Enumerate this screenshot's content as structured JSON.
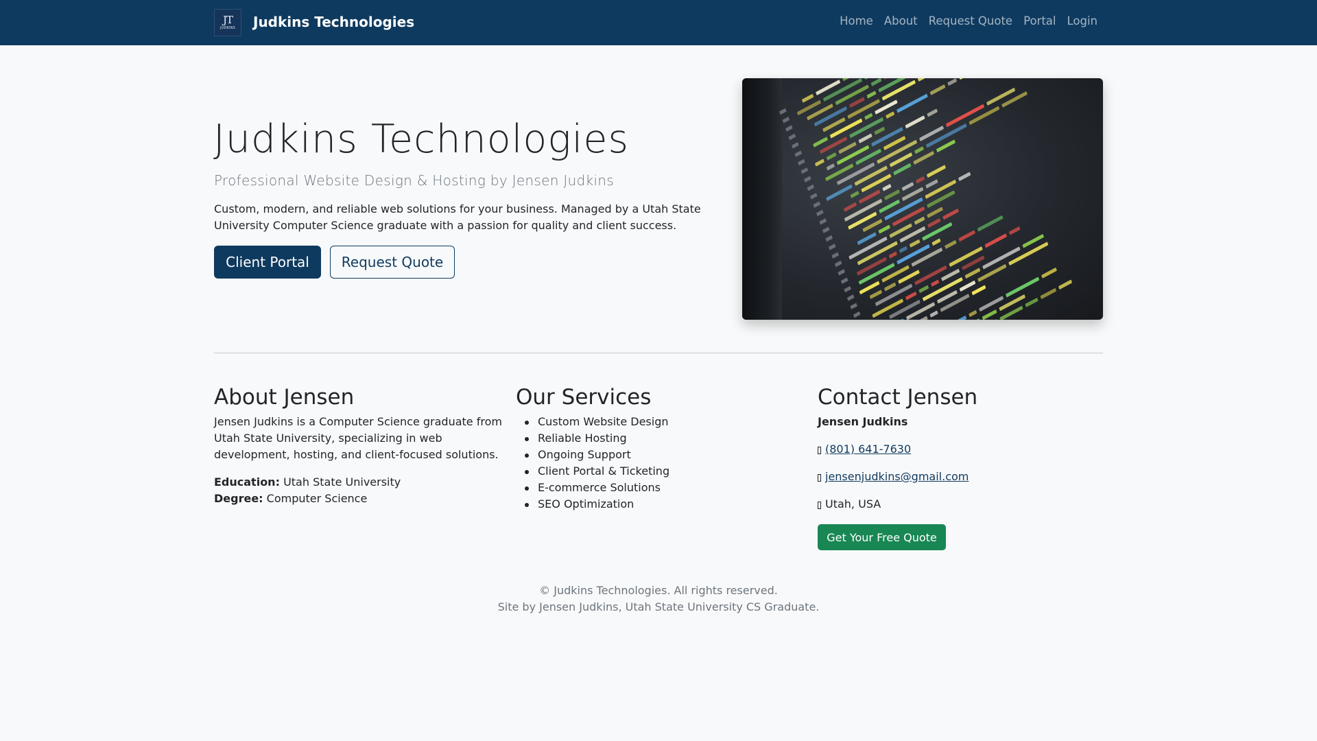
{
  "navbar": {
    "logo_monogram": "JT",
    "logo_subtext": "JUDKINS",
    "brand": "Judkins Technologies",
    "links": [
      "Home",
      "About",
      "Request Quote",
      "Portal",
      "Login"
    ]
  },
  "hero": {
    "title": "Judkins Technologies",
    "subtitle": "Professional Website Design & Hosting by Jensen Judkins",
    "description": "Custom, modern, and reliable web solutions for your business. Managed by a Utah State University Computer Science graduate with a passion for quality and client success.",
    "primary_button": "Client Portal",
    "secondary_button": "Request Quote",
    "image_icon": "code-screen-photo"
  },
  "about": {
    "title": "About Jensen",
    "text": "Jensen Judkins is a Computer Science graduate from Utah State University, specializing in web development, hosting, and client-focused solutions.",
    "education_label": "Education:",
    "education_value": "Utah State University",
    "degree_label": "Degree:",
    "degree_value": "Computer Science"
  },
  "services": {
    "title": "Our Services",
    "items": [
      "Custom Website Design",
      "Reliable Hosting",
      "Ongoing Support",
      "Client Portal & Ticketing",
      "E-commerce Solutions",
      "SEO Optimization"
    ]
  },
  "contact": {
    "title": "Contact Jensen",
    "name": "Jensen Judkins",
    "phone": "(801) 641-7630",
    "email": "jensenjudkins@gmail.com",
    "location": "Utah, USA",
    "cta": "Get Your Free Quote",
    "phone_icon": "phone-icon",
    "email_icon": "envelope-icon",
    "location_icon": "location-icon"
  },
  "footer": {
    "line1": "© Judkins Technologies. All rights reserved.",
    "line2": "Site by Jensen Judkins, Utah State University CS Graduate."
  },
  "colors": {
    "navbar_bg": "#0f3a5f",
    "primary": "#0f3a5f",
    "success": "#198754",
    "page_bg": "#f8f9fa"
  }
}
